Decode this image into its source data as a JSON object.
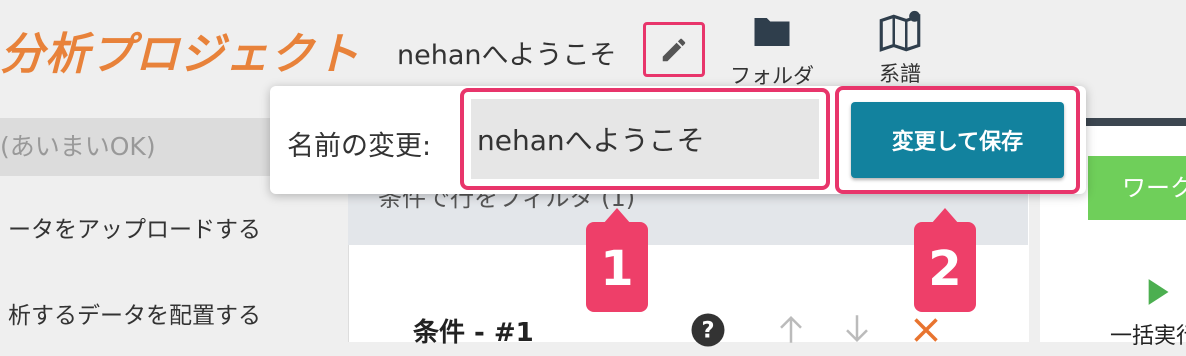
{
  "header": {
    "project_title": "分析プロジェクト",
    "welcome_text": "nehanへようこそ",
    "toolbar": [
      {
        "label": "フォルダ",
        "icon": "folder-icon"
      },
      {
        "label": "系譜",
        "icon": "map-lineage-icon"
      }
    ]
  },
  "sidebar": {
    "search_placeholder": "(あいまいOK)",
    "items": [
      {
        "label": "ータをアップロードする"
      },
      {
        "label": "析するデータを配置する"
      }
    ]
  },
  "main": {
    "section_title": "条件で行をフィルタ (1)",
    "condition_title": "条件 - #1"
  },
  "right_panel": {
    "action_button": "ワークフ",
    "run_all_label": "一括実行"
  },
  "rename_popup": {
    "label": "名前の変更:",
    "input_value": "nehanへようこそ",
    "save_button": "変更して保存"
  },
  "annotations": {
    "badge1": "1",
    "badge2": "2"
  },
  "colors": {
    "accent_orange": "#e8823a",
    "highlight_pink": "#e8356b",
    "save_button": "#12829e",
    "green_button": "#6fcf5a",
    "delete_orange": "#e8742f"
  }
}
